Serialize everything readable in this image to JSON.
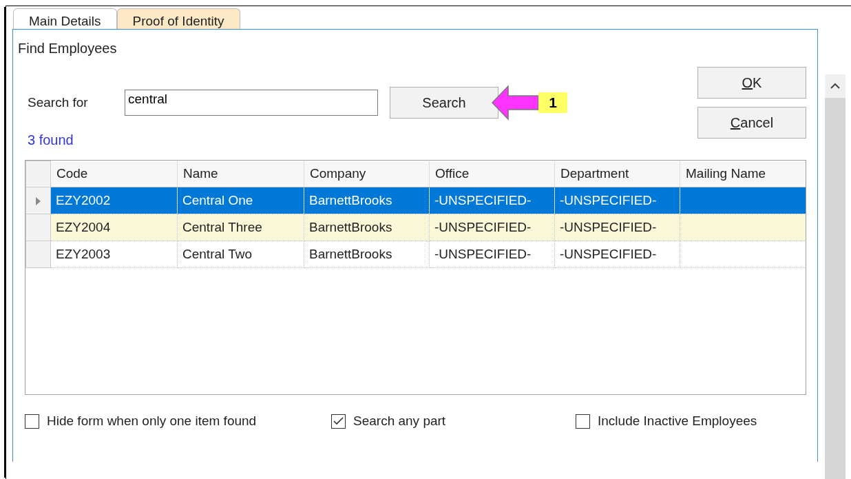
{
  "tabs": [
    {
      "label": "Main Details",
      "selected": false
    },
    {
      "label": "Proof of Identity",
      "selected": true
    }
  ],
  "dialog": {
    "title": "Find Employees",
    "search": {
      "label": "Search for",
      "value": "central",
      "button": "Search"
    },
    "annotation": {
      "label": "1"
    },
    "buttons": [
      {
        "mnemonic": "O",
        "rest": "K"
      },
      {
        "mnemonic": "C",
        "rest": "ancel"
      }
    ],
    "result_count": "3 found",
    "table": {
      "columns": [
        "Code",
        "Name",
        "Company",
        "Office",
        "Department",
        "Mailing Name"
      ],
      "rows": [
        {
          "selected": true,
          "current": true,
          "cells": [
            "EZY2002",
            "Central One",
            "BarnettBrooks",
            "-UNSPECIFIED-",
            "-UNSPECIFIED-",
            ""
          ]
        },
        {
          "selected": false,
          "current": false,
          "cells": [
            "EZY2004",
            "Central Three",
            "BarnettBrooks",
            "-UNSPECIFIED-",
            "-UNSPECIFIED-",
            ""
          ]
        },
        {
          "selected": false,
          "current": false,
          "cells": [
            "EZY2003",
            "Central Two",
            "BarnettBrooks",
            "-UNSPECIFIED-",
            "-UNSPECIFIED-",
            ""
          ]
        }
      ]
    },
    "options": [
      {
        "label": "Hide form when only one item found",
        "checked": false
      },
      {
        "label": "Search any part",
        "checked": true
      },
      {
        "label": "Include Inactive Employees",
        "checked": false
      }
    ]
  }
}
